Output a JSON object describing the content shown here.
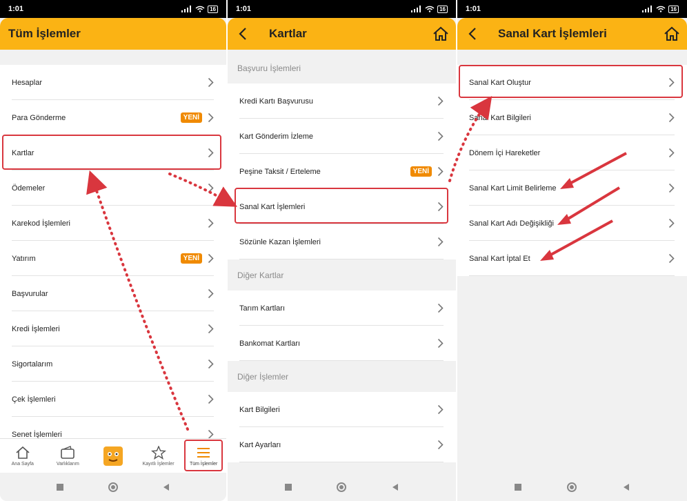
{
  "status": {
    "time": "1:01",
    "battery": "16"
  },
  "panel1": {
    "title": "Tüm İşlemler",
    "items": [
      {
        "label": "Hesaplar",
        "badge": ""
      },
      {
        "label": "Para Gönderme",
        "badge": "YENİ"
      },
      {
        "label": "Kartlar",
        "badge": ""
      },
      {
        "label": "Ödemeler",
        "badge": ""
      },
      {
        "label": "Karekod İşlemleri",
        "badge": ""
      },
      {
        "label": "Yatırım",
        "badge": "YENİ"
      },
      {
        "label": "Başvurular",
        "badge": ""
      },
      {
        "label": "Kredi İşlemleri",
        "badge": ""
      },
      {
        "label": "Sigortalarım",
        "badge": ""
      },
      {
        "label": "Çek İşlemleri",
        "badge": ""
      },
      {
        "label": "Senet İşlemleri",
        "badge": ""
      }
    ],
    "nav": [
      {
        "label": "Ana Sayfa",
        "icon": "home-icon"
      },
      {
        "label": "Varlıklarım",
        "icon": "wallet-icon"
      },
      {
        "label": "",
        "icon": "mascot-icon"
      },
      {
        "label": "Kayıtlı İşlemler",
        "icon": "star-icon"
      },
      {
        "label": "Tüm İşlemler",
        "icon": "menu-icon"
      }
    ]
  },
  "panel2": {
    "title": "Kartlar",
    "sections": [
      {
        "header": "Başvuru İşlemleri",
        "items": [
          {
            "label": "Kredi Kartı Başvurusu",
            "badge": ""
          },
          {
            "label": "Kart Gönderim İzleme",
            "badge": ""
          },
          {
            "label": "Peşine Taksit / Erteleme",
            "badge": "YENİ"
          },
          {
            "label": "Sanal Kart İşlemleri",
            "badge": ""
          },
          {
            "label": "Sözünle Kazan İşlemleri",
            "badge": ""
          }
        ]
      },
      {
        "header": "Diğer Kartlar",
        "items": [
          {
            "label": "Tarım Kartları",
            "badge": ""
          },
          {
            "label": "Bankomat Kartları",
            "badge": ""
          }
        ]
      },
      {
        "header": "Diğer İşlemler",
        "items": [
          {
            "label": "Kart Bilgileri",
            "badge": ""
          },
          {
            "label": "Kart Ayarları",
            "badge": ""
          }
        ]
      }
    ]
  },
  "panel3": {
    "title": "Sanal Kart İşlemleri",
    "items": [
      {
        "label": "Sanal Kart Oluştur"
      },
      {
        "label": "Sanal Kart Bilgileri"
      },
      {
        "label": "Dönem İçi Hareketler"
      },
      {
        "label": "Sanal Kart Limit Belirleme"
      },
      {
        "label": "Sanal Kart Adı Değişikliği"
      },
      {
        "label": "Sanal Kart İptal Et"
      }
    ]
  },
  "colors": {
    "accent": "#fbb314",
    "badge": "#f08a00",
    "highlight": "#d9363e"
  }
}
